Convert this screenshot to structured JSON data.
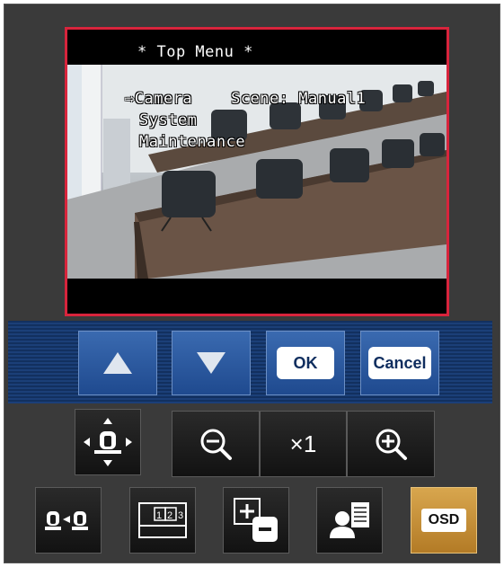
{
  "osd": {
    "title": "* Top Menu *",
    "row1": "⇨Camera    Scene: Manual1",
    "row2": "System",
    "row3": "Maintenance"
  },
  "nav": {
    "up_icon": "up-arrow-icon",
    "down_icon": "down-arrow-icon",
    "ok_label": "OK",
    "cancel_label": "Cancel"
  },
  "zoom": {
    "out_icon": "zoom-out-icon",
    "level": "×1",
    "in_icon": "zoom-in-icon"
  },
  "controls": {
    "ptz_icon": "pan-tilt-icon",
    "preset_icon": "camera-preset-icon",
    "multi_screen_digits": "1 2 3",
    "plus_minus_icon": "plus-minus-icon",
    "user_icon": "user-list-icon",
    "osd_label": "OSD"
  },
  "colors": {
    "video_border": "#d8243c",
    "nav_bar": "#1b3f78",
    "osd_button": "#c8913a"
  }
}
